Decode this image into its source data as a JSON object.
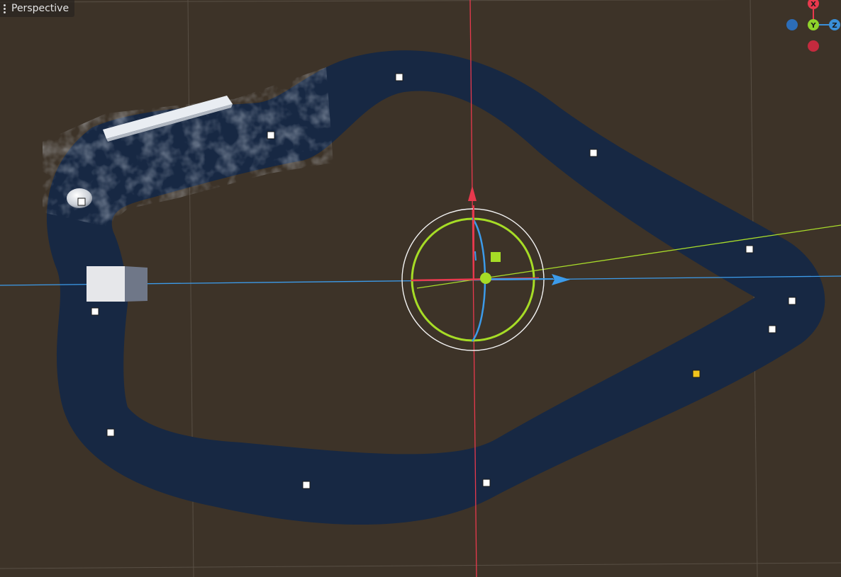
{
  "viewport": {
    "menu_label": "Perspective",
    "menu_icon": "kebab-menu-icon"
  },
  "axis_gizmo": {
    "x_label": "X",
    "y_label": "Y",
    "z_label": "Z",
    "colors": {
      "x": "#e8394d",
      "y": "#8fd32b",
      "z": "#3a8fd8"
    }
  },
  "scene": {
    "ground_color": "#3d3328",
    "path_color": "#172843",
    "selected_point_color": "#f2c41c",
    "control_point_color": "#ffffff"
  }
}
